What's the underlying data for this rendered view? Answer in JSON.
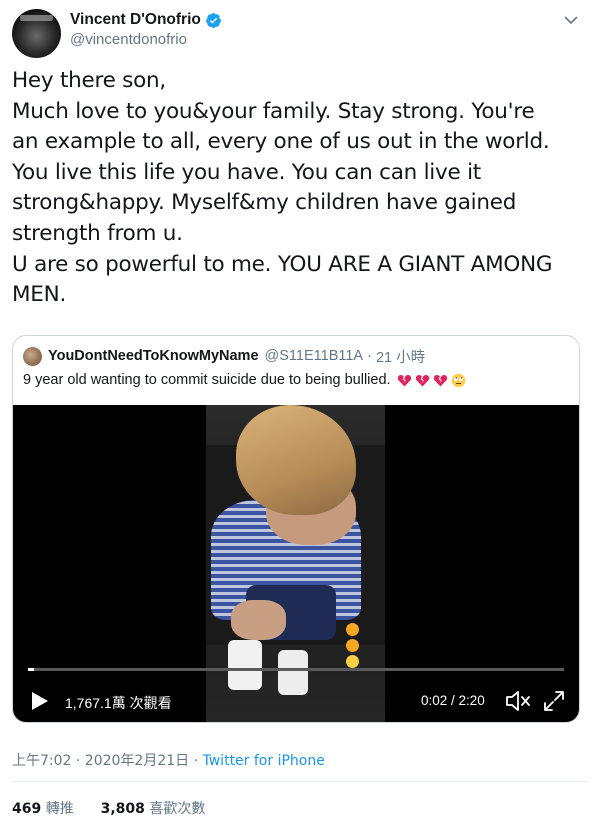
{
  "author": {
    "display_name": "Vincent D'Onofrio",
    "handle": "@vincentdonofrio",
    "verified": true
  },
  "tweet_lines": [
    "Hey there son,",
    "Much love to you&your family. Stay strong. You're",
    "an example to all, every one of us out in the world.",
    "You live this life you have. You can can live it",
    "strong&happy. Myself&my children have gained",
    "strength from u.",
    "U are so powerful to me. YOU ARE A GIANT AMONG",
    "MEN."
  ],
  "quoted": {
    "name": "YouDontNeedToKnowMyName",
    "handle": "@S11E11B11A",
    "separator": "·",
    "time": "21 小時",
    "text": "9 year old wanting to commit suicide due to being bullied.",
    "emojis": [
      "broken-heart-icon",
      "broken-heart-icon",
      "broken-heart-icon",
      "rolling-eyes-icon"
    ],
    "video": {
      "views": "1,767.1萬 次觀看",
      "time": "0:02 / 2:20",
      "progress": 0.012
    }
  },
  "meta": {
    "timestamp": "上午7:02 · 2020年2月21日",
    "separator": " · ",
    "source": "Twitter for iPhone"
  },
  "stats": {
    "retweets": "469",
    "retweets_label": "轉推",
    "likes": "3,808",
    "likes_label": "喜歡次數"
  },
  "colors": {
    "accent": "#1b95e0",
    "muted": "#657786",
    "text": "#14171a",
    "border": "#ccd6dd",
    "broken_heart": "#e0245e"
  }
}
